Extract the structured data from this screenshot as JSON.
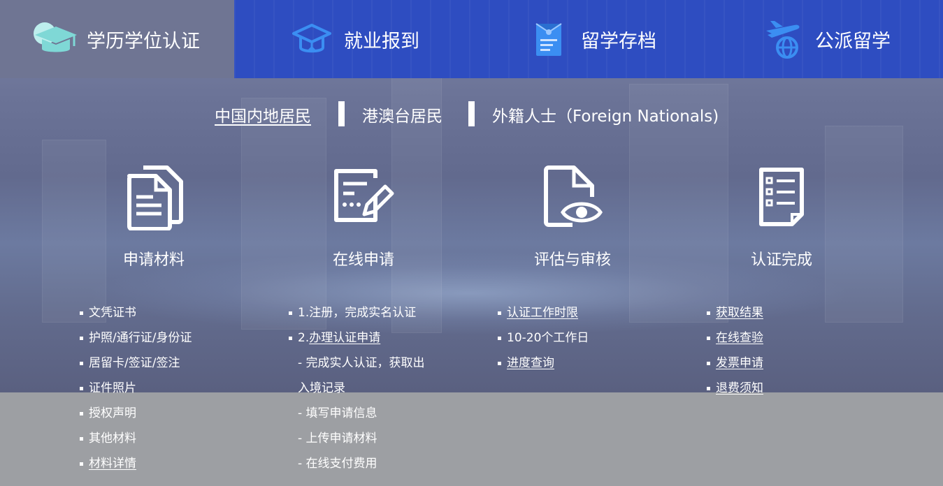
{
  "tabs": [
    {
      "label": "学历学位认证",
      "icon": "graduation-cap-icon",
      "active": true
    },
    {
      "label": "就业报到",
      "icon": "mortarboard-report-icon",
      "active": false
    },
    {
      "label": "留学存档",
      "icon": "archive-document-icon",
      "active": false
    },
    {
      "label": "公派留学",
      "icon": "plane-globe-icon",
      "active": false
    }
  ],
  "subnav": {
    "items": [
      "中国内地居民",
      "港澳台居民",
      "外籍人士（Foreign Nationals)"
    ],
    "active": 0
  },
  "steps": [
    {
      "title": "申请材料",
      "icon": "documents-icon",
      "items": [
        "文凭证书",
        "护照/通行证/身份证",
        "居留卡/签证/签注",
        "证件照片",
        "授权声明",
        "其他材料",
        "材料详情"
      ]
    },
    {
      "title": "在线申请",
      "icon": "form-edit-icon",
      "items": [
        "1.注册，完成实名认证"
      ],
      "item2_prefix": "2.",
      "item2_link": "办理认证申请",
      "subitems": [
        "- 完成实人认证，获取出",
        "入境记录",
        "- 填写申请信息",
        "- 上传申请材料",
        "- 在线支付费用"
      ]
    },
    {
      "title": "评估与审核",
      "icon": "document-eye-icon",
      "items": [
        "认证工作时限",
        "10-20个工作日",
        "进度查询"
      ]
    },
    {
      "title": "认证完成",
      "icon": "checklist-icon",
      "items": [
        "获取结果",
        "在线查验",
        "发票申请",
        "退费须知"
      ]
    }
  ],
  "colors": {
    "tab_active_bg": "#6f7593",
    "tab_bar_bg": "#2e4dc1",
    "icon_teal": "#7fd8d6",
    "icon_blue": "#3b8ef2"
  }
}
